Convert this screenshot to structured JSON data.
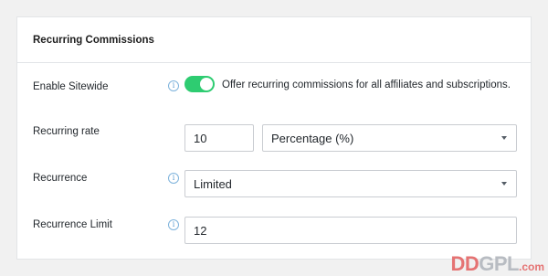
{
  "panel": {
    "title": "Recurring Commissions"
  },
  "rows": {
    "enable_sitewide": {
      "label": "Enable Sitewide",
      "toggle_on": true,
      "description": "Offer recurring commissions for all affiliates and subscriptions."
    },
    "recurring_rate": {
      "label": "Recurring rate",
      "value": "10",
      "type_selected": "Percentage (%)"
    },
    "recurrence": {
      "label": "Recurrence",
      "selected": "Limited"
    },
    "recurrence_limit": {
      "label": "Recurrence Limit",
      "value": "12"
    }
  },
  "icons": {
    "info": "info-icon",
    "info_glyph": "i",
    "dropdown": "chevron-down-icon"
  },
  "colors": {
    "toggle_on": "#2ecc71",
    "info_icon": "#5a9bd0",
    "watermark_red": "#e57373"
  },
  "watermark": {
    "brand_dd": "DD",
    "brand_gpl": "GPL",
    "brand_tld": ".com"
  }
}
